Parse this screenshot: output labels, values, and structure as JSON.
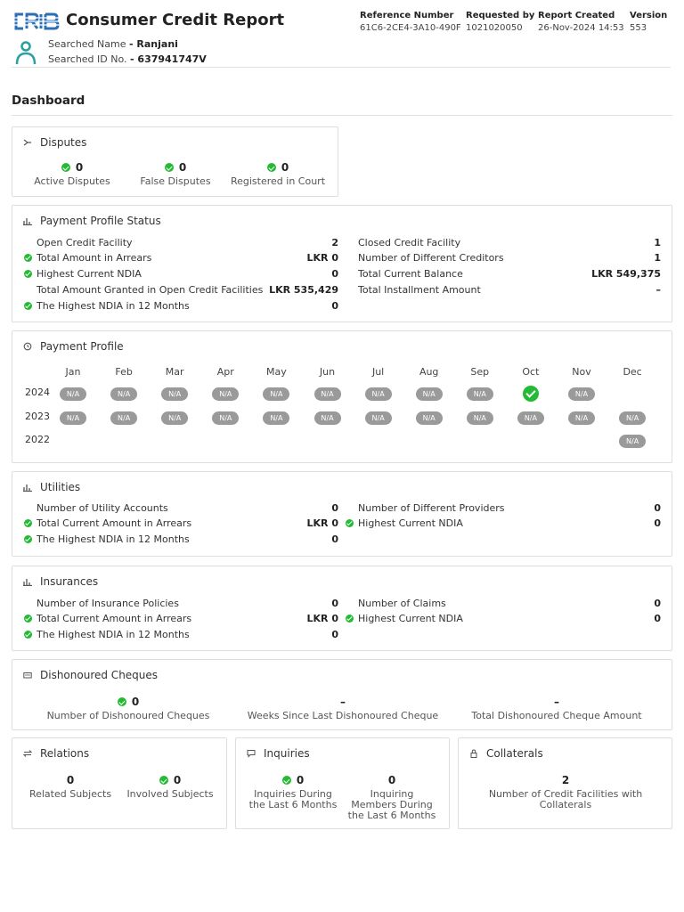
{
  "header": {
    "logo_text": "CRIB",
    "title": "Consumer Credit Report",
    "searched_name_label": "Searched Name",
    "searched_name_value": "- Ranjani",
    "searched_id_label": "Searched ID No.",
    "searched_id_value": "- 637941747V",
    "meta": [
      {
        "label": "Reference Number",
        "value": "61C6-2CE4-3A10-490F"
      },
      {
        "label": "Requested by",
        "value": "1021020050"
      },
      {
        "label": "Report Created",
        "value": "26-Nov-2024 14:53"
      },
      {
        "label": "Version",
        "value": "553"
      }
    ]
  },
  "dashboard_title": "Dashboard",
  "disputes": {
    "title": "Disputes",
    "items": [
      {
        "value": "0",
        "label": "Active Disputes"
      },
      {
        "value": "0",
        "label": "False Disputes"
      },
      {
        "value": "0",
        "label": "Registered in Court"
      }
    ]
  },
  "payment_profile_status": {
    "title": "Payment Profile Status",
    "left": [
      {
        "label": "Open Credit Facility",
        "value": "2",
        "check": false
      },
      {
        "label": "Total Amount in Arrears",
        "value": "LKR 0",
        "check": true
      },
      {
        "label": "Highest Current NDIA",
        "value": "0",
        "check": true
      },
      {
        "label": "Total Amount Granted in Open Credit Facilities",
        "value": "LKR 535,429",
        "check": false
      },
      {
        "label": "The Highest NDIA in 12 Months",
        "value": "0",
        "check": true
      }
    ],
    "right": [
      {
        "label": "Closed Credit Facility",
        "value": "1",
        "check": false
      },
      {
        "label": "Number of Different Creditors",
        "value": "1",
        "check": false
      },
      {
        "label": "Total Current Balance",
        "value": "LKR 549,375",
        "check": false
      },
      {
        "label": "Total Installment Amount",
        "value": "–",
        "check": false
      }
    ]
  },
  "payment_profile": {
    "title": "Payment Profile",
    "months": [
      "Jan",
      "Feb",
      "Mar",
      "Apr",
      "May",
      "Jun",
      "Jul",
      "Aug",
      "Sep",
      "Oct",
      "Nov",
      "Dec"
    ],
    "years": [
      {
        "year": "2024",
        "cells": [
          "N/A",
          "N/A",
          "N/A",
          "N/A",
          "N/A",
          "N/A",
          "N/A",
          "N/A",
          "N/A",
          "OK",
          "N/A",
          ""
        ]
      },
      {
        "year": "2023",
        "cells": [
          "N/A",
          "N/A",
          "N/A",
          "N/A",
          "N/A",
          "N/A",
          "N/A",
          "N/A",
          "N/A",
          "N/A",
          "N/A",
          "N/A"
        ]
      },
      {
        "year": "2022",
        "cells": [
          "",
          "",
          "",
          "",
          "",
          "",
          "",
          "",
          "",
          "",
          "",
          "N/A"
        ]
      }
    ]
  },
  "utilities": {
    "title": "Utilities",
    "left": [
      {
        "label": "Number of Utility Accounts",
        "value": "0",
        "check": false
      },
      {
        "label": "Total Current Amount in Arrears",
        "value": "LKR 0",
        "check": true
      },
      {
        "label": "The Highest NDIA in 12 Months",
        "value": "0",
        "check": true
      }
    ],
    "right": [
      {
        "label": "Number of Different Providers",
        "value": "0",
        "check": false
      },
      {
        "label": "Highest Current NDIA",
        "value": "0",
        "check": true
      }
    ]
  },
  "insurances": {
    "title": "Insurances",
    "left": [
      {
        "label": "Number of Insurance Policies",
        "value": "0",
        "check": false
      },
      {
        "label": "Total Current Amount in Arrears",
        "value": "LKR 0",
        "check": true
      },
      {
        "label": "The Highest NDIA in 12 Months",
        "value": "0",
        "check": true
      }
    ],
    "right": [
      {
        "label": "Number of Claims",
        "value": "0",
        "check": false
      },
      {
        "label": "Highest Current NDIA",
        "value": "0",
        "check": true
      }
    ]
  },
  "dishonoured": {
    "title": "Dishonoured Cheques",
    "items": [
      {
        "value": "0",
        "label": "Number of Dishonoured Cheques"
      },
      {
        "value": "–",
        "label": "Weeks Since Last Dishonoured Cheque"
      },
      {
        "value": "–",
        "label": "Total Dishonoured Cheque Amount"
      }
    ]
  },
  "relations": {
    "title": "Relations",
    "items": [
      {
        "value": "0",
        "label": "Related Subjects"
      },
      {
        "value": "0",
        "label": "Involved Subjects"
      }
    ]
  },
  "inquiries": {
    "title": "Inquiries",
    "items": [
      {
        "value": "0",
        "label_lines": [
          "Inquiries During",
          "the Last 6 Months"
        ]
      },
      {
        "value": "0",
        "label_lines": [
          "Inquiring",
          "Members During",
          "the Last 6 Months"
        ]
      }
    ]
  },
  "collaterals": {
    "title": "Collaterals",
    "items": [
      {
        "value": "2",
        "label_lines": [
          "Number of Credit Facilities with",
          "Collaterals"
        ]
      }
    ]
  },
  "colors": {
    "brand_blue": "#2d6fb5",
    "ok_green": "#22bb33",
    "na_gray": "#9a9a9a"
  }
}
